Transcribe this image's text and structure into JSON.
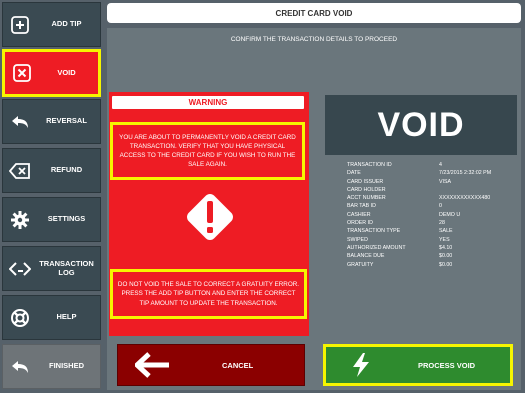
{
  "sidebar": {
    "items": [
      {
        "label": "ADD TIP",
        "icon": "plus-square-icon"
      },
      {
        "label": "VOID",
        "icon": "x-square-icon"
      },
      {
        "label": "REVERSAL",
        "icon": "reply-arrow-icon"
      },
      {
        "label": "REFUND",
        "icon": "backspace-icon"
      },
      {
        "label": "SETTINGS",
        "icon": "gear-icon"
      },
      {
        "label": "TRANSACTION LOG",
        "icon": "code-brackets-icon"
      },
      {
        "label": "HELP",
        "icon": "lifebuoy-icon"
      },
      {
        "label": "FINISHED",
        "icon": "reply-arrow-icon"
      }
    ]
  },
  "header": {
    "title": "CREDIT CARD VOID"
  },
  "main": {
    "confirm_text": "CONFIRM THE TRANSACTION DETAILS TO PROCEED",
    "warning_title": "WARNING",
    "warning_text": "YOU ARE ABOUT TO PERMANENTLY VOID A CREDIT CARD TRANSACTION. VERIFY THAT YOU HAVE PHYSICAL ACCESS TO THE CREDIT CARD IF YOU WISH TO RUN THE SALE AGAIN.",
    "gratuity_text": "DO NOT VOID THE SALE TO CORRECT A GRATUITY ERROR. PRESS THE ADD TIP BUTTON AND ENTER THE CORRECT TIP AMOUNT TO UPDATE THE TRANSACTION.",
    "void_label": "VOID",
    "details": [
      {
        "label": "TRANSACTION ID",
        "value": "4"
      },
      {
        "label": "DATE",
        "value": "7/23/2015 2:32:02 PM"
      },
      {
        "label": "CARD ISSUER",
        "value": "VISA"
      },
      {
        "label": "CARD HOLDER",
        "value": ""
      },
      {
        "label": "ACCT NUMBER",
        "value": "XXXXXXXXXXXX480"
      },
      {
        "label": "BAR TAB ID",
        "value": "0"
      },
      {
        "label": "CASHIER",
        "value": "DEMO U"
      },
      {
        "label": "ORDER ID",
        "value": "28"
      },
      {
        "label": "TRANSACTION TYPE",
        "value": "SALE"
      },
      {
        "label": "SWIPED",
        "value": "YES"
      },
      {
        "label": "AUTHORIZED AMOUNT",
        "value": "$4.10"
      },
      {
        "label": "BALANCE DUE",
        "value": "$0.00"
      },
      {
        "label": "GRATUITY",
        "value": "$0.00"
      }
    ]
  },
  "buttons": {
    "cancel_label": "CANCEL",
    "process_label": "PROCESS VOID"
  },
  "colors": {
    "accent_red": "#ee1c24",
    "highlight_yellow": "#f6f500",
    "process_green": "#2e8b2e",
    "cancel_darkred": "#8b0000"
  }
}
